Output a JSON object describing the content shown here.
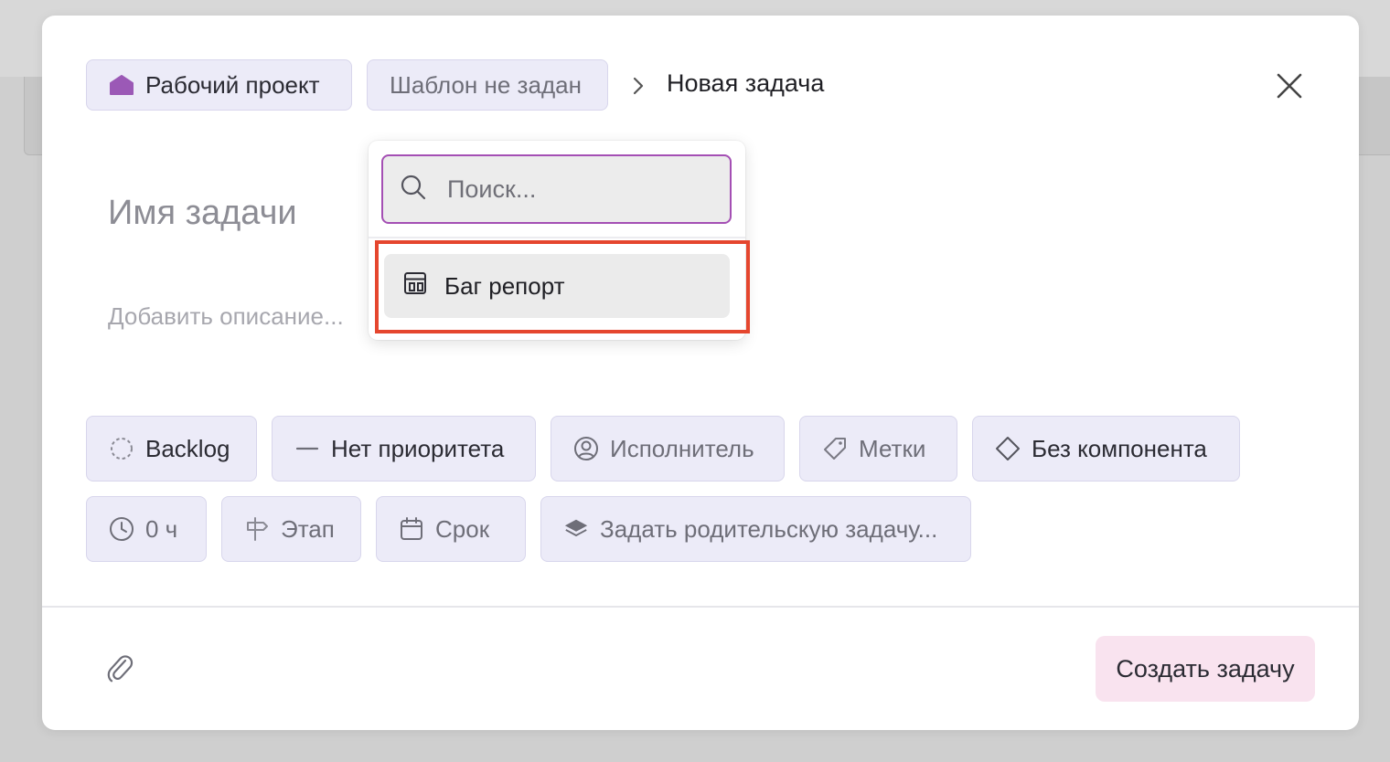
{
  "breadcrumb": {
    "project_label": "Рабочий проект",
    "template_label": "Шаблон не задан",
    "current_title": "Новая задача"
  },
  "form": {
    "task_name_placeholder": "Имя задачи",
    "description_placeholder": "Добавить описание..."
  },
  "properties": {
    "row1": {
      "status": "Backlog",
      "priority": "Нет приоритета",
      "assignee": "Исполнитель",
      "labels": "Метки",
      "component": "Без компонента"
    },
    "row2": {
      "estimate": "0 ч",
      "stage": "Этап",
      "due": "Срок",
      "parent": "Задать родительскую задачу..."
    }
  },
  "template_dropdown": {
    "search_placeholder": "Поиск...",
    "items": [
      {
        "label": "Баг репорт",
        "icon": "template-layout-icon"
      }
    ]
  },
  "footer": {
    "create_label": "Создать задачу"
  },
  "colors": {
    "chip_bg": "#ecebf8",
    "project_icon": "#9b59b6",
    "search_border": "#a44fb4",
    "create_bg": "#f9e3ef",
    "highlight": "#e5462e"
  }
}
